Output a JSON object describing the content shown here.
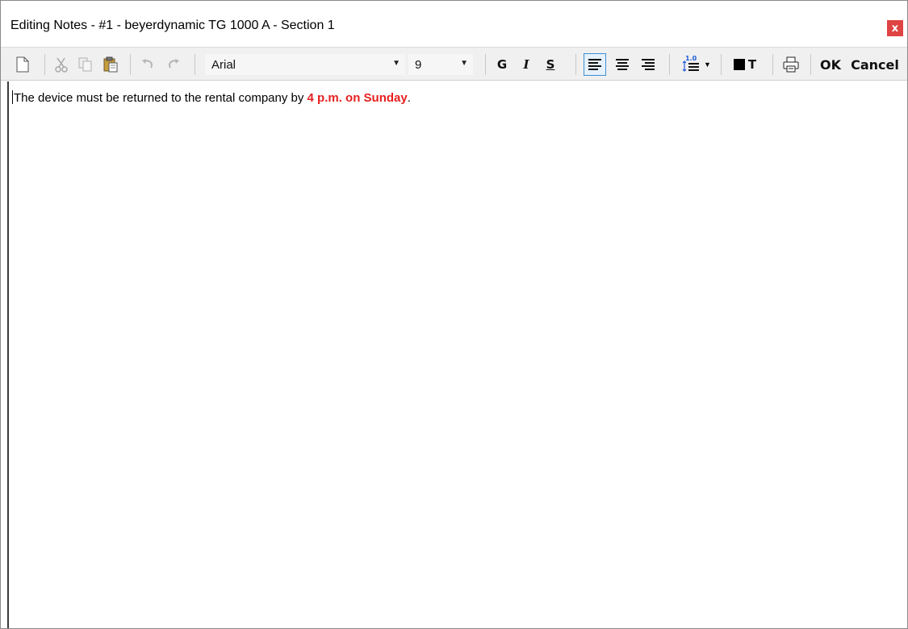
{
  "window": {
    "title": "Editing Notes - #1 - beyerdynamic TG 1000 A  -  Section 1",
    "close_label": "x"
  },
  "toolbar": {
    "font_name": "Arial",
    "font_size": "9",
    "bold_label": "G",
    "italic_label": "I",
    "strikeout_label": "S",
    "line_spacing_value": "1.0",
    "text_color_label": "T",
    "ok_label": "OK",
    "cancel_label": "Cancel"
  },
  "editor": {
    "text_before": "The device must be returned to the rental company by ",
    "text_highlight": "4 p.m. on Sunday",
    "text_after": "."
  },
  "colors": {
    "highlight_text": "#e62020",
    "close_button": "#e04343",
    "align_active_border": "#3d8fd6"
  }
}
